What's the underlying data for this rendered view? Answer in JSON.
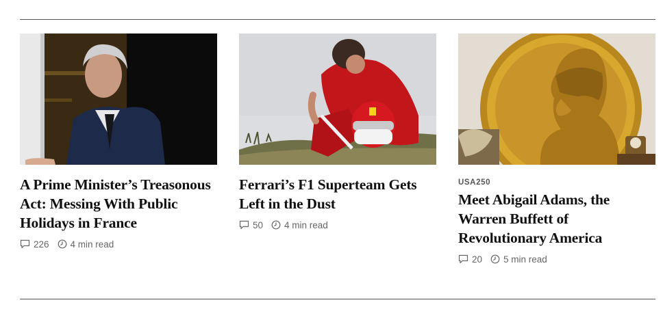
{
  "articles": [
    {
      "kicker": "",
      "headline": "A Prime Minister’s Treasonous Act: Messing With Public Holidays in France",
      "comments": "226",
      "read_time": "4 min read",
      "image_icon": "portrait-photo"
    },
    {
      "kicker": "",
      "headline": "Ferrari’s F1 Superteam Gets Left in the Dust",
      "comments": "50",
      "read_time": "4 min read",
      "image_icon": "race-driver-photo"
    },
    {
      "kicker": "USA250",
      "headline": "Meet Abigail Adams, the Warren Buffett of Revolutionary America",
      "comments": "20",
      "read_time": "5 min read",
      "image_icon": "gold-coin-illustration"
    }
  ],
  "icons": {
    "comment": "comment-icon",
    "clock": "clock-icon"
  },
  "colors": {
    "headline": "#111111",
    "meta": "#666666",
    "rule": "#555555",
    "kicker": "#555555"
  }
}
